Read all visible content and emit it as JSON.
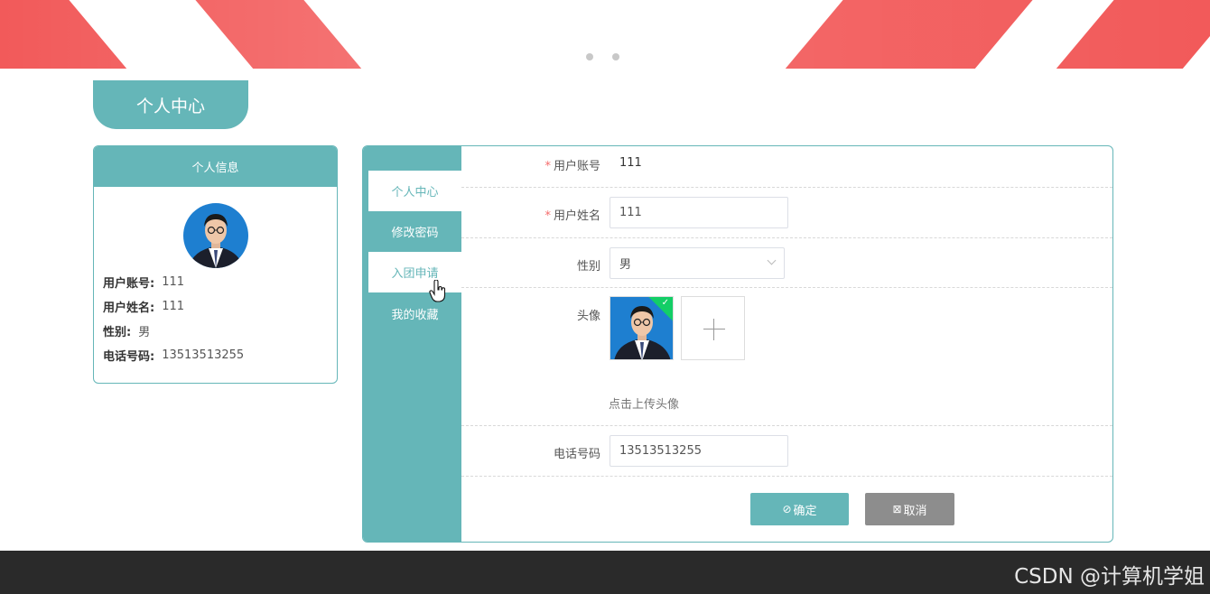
{
  "header": {
    "title_tab": "个人中心"
  },
  "info_card": {
    "title": "个人信息",
    "rows": [
      {
        "label": "用户账号:",
        "value": "111"
      },
      {
        "label": "用户姓名:",
        "value": "111"
      },
      {
        "label": "性别:",
        "value": "男"
      },
      {
        "label": "电话号码:",
        "value": "13513513255"
      }
    ]
  },
  "side_nav": {
    "items": [
      {
        "label": "个人中心"
      },
      {
        "label": "修改密码"
      },
      {
        "label": "入团申请"
      },
      {
        "label": "我的收藏"
      }
    ]
  },
  "form": {
    "account": {
      "label": "用户账号",
      "value": "111",
      "required": "*"
    },
    "name": {
      "label": "用户姓名",
      "value": "111",
      "required": "*"
    },
    "gender": {
      "label": "性别",
      "value": "男"
    },
    "avatar": {
      "label": "头像",
      "hint": "点击上传头像"
    },
    "phone": {
      "label": "电话号码",
      "value": "13513513255"
    },
    "buttons": {
      "confirm": "确定",
      "cancel": "取消"
    }
  },
  "colors": {
    "accent": "#65b6b8",
    "banner": "#f25a5a",
    "footer": "#2a2a2a",
    "success": "#13ce66"
  },
  "icons": {
    "confirm": "check-circle-icon",
    "cancel": "close-square-icon",
    "upload": "plus-icon",
    "select": "chevron-down-icon",
    "cursor": "hand-pointer-icon"
  },
  "footer": {
    "watermark": "CSDN @计算机学姐"
  }
}
